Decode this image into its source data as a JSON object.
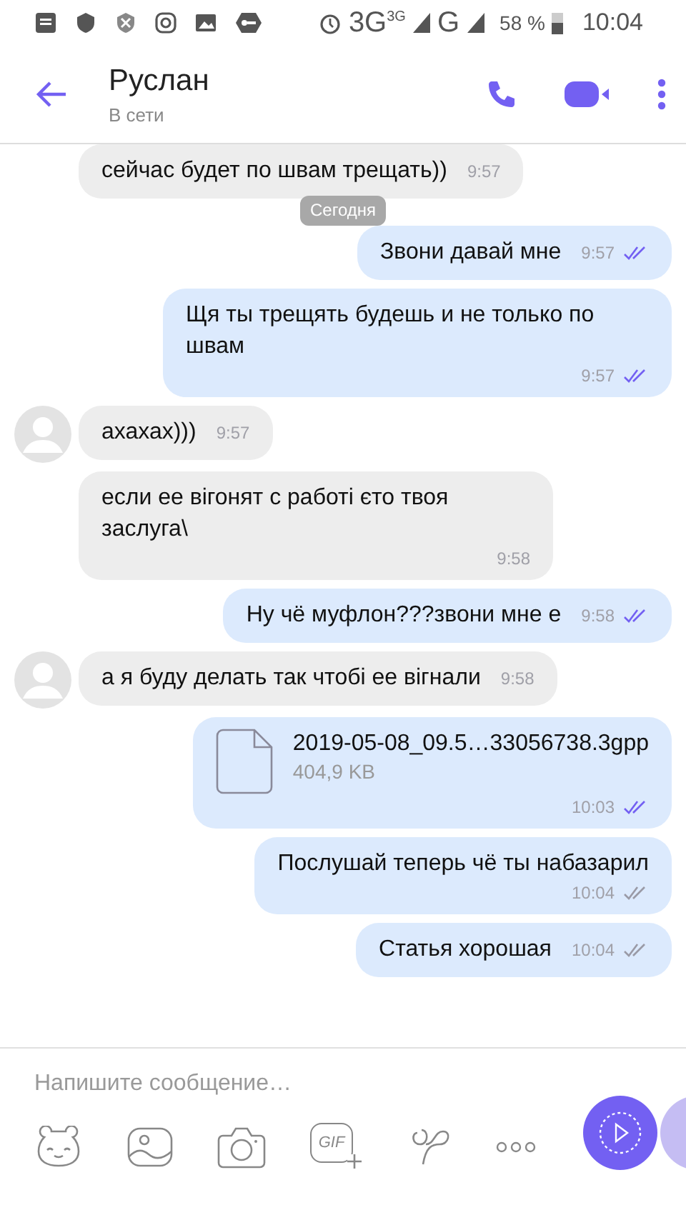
{
  "status_bar": {
    "network_1": "3G",
    "network_1_sup": "3G",
    "network_2": "G",
    "battery": "58 %",
    "time": "10:04"
  },
  "header": {
    "title": "Руслан",
    "subtitle": "В сети"
  },
  "date_chip": "Сегодня",
  "messages": [
    {
      "kind": "text",
      "outgoing": false,
      "avatar": false,
      "text": "сейчас будет по швам трещать))",
      "time": "9:57",
      "time_below": false
    },
    {
      "kind": "text",
      "outgoing": true,
      "text": "Звони давай мне",
      "time": "9:57",
      "time_below": false,
      "read": true
    },
    {
      "kind": "text",
      "outgoing": true,
      "text": "Щя ты трещять будешь и не только по швам",
      "time": "9:57",
      "time_below": true,
      "read": true
    },
    {
      "kind": "text",
      "outgoing": false,
      "avatar": true,
      "text": "ахахах)))",
      "time": "9:57",
      "time_below": false
    },
    {
      "kind": "text",
      "outgoing": false,
      "avatar": false,
      "text": "если ее вігонят с работі єто твоя заслуга\\",
      "time": "9:58",
      "time_below": true
    },
    {
      "kind": "text",
      "outgoing": true,
      "text": "Ну чё муфлон???звони мне е",
      "time": "9:58",
      "time_below": false,
      "read": true
    },
    {
      "kind": "text",
      "outgoing": false,
      "avatar": true,
      "text": "а я буду делать так чтобі ее вігнали",
      "time": "9:58",
      "time_below": false
    },
    {
      "kind": "file",
      "outgoing": true,
      "text": "2019-05-08_09.5…33056738.3gpp",
      "size": "404,9 KB",
      "time": "10:03",
      "time_below": true,
      "read": true
    },
    {
      "kind": "text",
      "outgoing": true,
      "text": "Послушай теперь чё ты набазарил",
      "time": "10:04",
      "time_below": true,
      "read": false
    },
    {
      "kind": "text",
      "outgoing": true,
      "text": "Статья хорошая",
      "time": "10:04",
      "time_below": false,
      "read": false
    }
  ],
  "composer": {
    "placeholder": "Напишите сообщение…",
    "gif_label": "GIF"
  }
}
